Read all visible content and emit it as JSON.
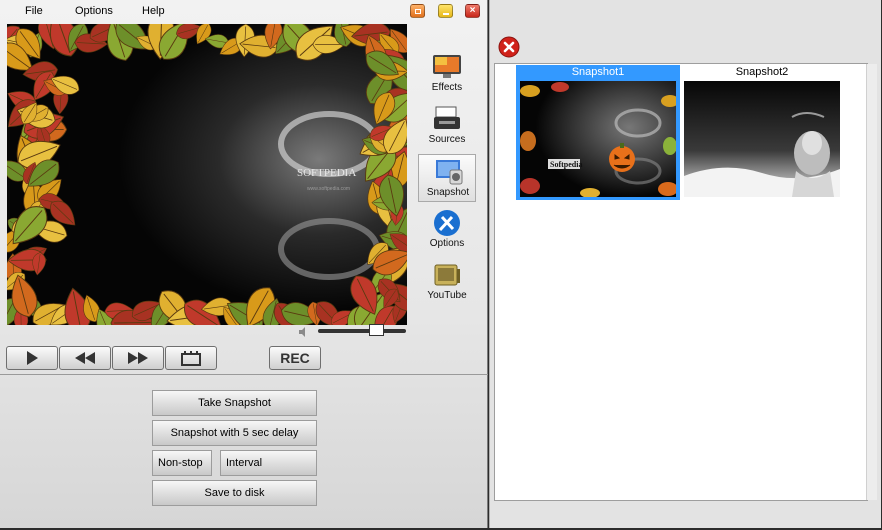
{
  "menu": {
    "items": [
      "File",
      "Options",
      "Help"
    ]
  },
  "window_controls": [
    "restore",
    "minimize",
    "close"
  ],
  "side_tools": [
    {
      "label": "Effects",
      "icon": "effects-monitor-icon",
      "active": false
    },
    {
      "label": "Sources",
      "icon": "sources-printer-icon",
      "active": false
    },
    {
      "label": "Snapshot",
      "icon": "snapshot-camera-icon",
      "active": true
    },
    {
      "label": "Options",
      "icon": "options-tools-icon",
      "active": false
    },
    {
      "label": "YouTube",
      "icon": "youtube-tv-icon",
      "active": false
    }
  ],
  "preview": {
    "watermark": "SOFTPEDIA",
    "caption": "www.softpedia.com"
  },
  "volume": {
    "level": 0.7
  },
  "controls": {
    "rec_label": "REC"
  },
  "actions": {
    "take_snapshot": "Take Snapshot",
    "snapshot_delay": "Snapshot with 5 sec delay",
    "non_stop": "Non-stop",
    "interval": "Interval",
    "save_to_disk": "Save to disk"
  },
  "snapshots": [
    {
      "title": "Snapshot1",
      "selected": true,
      "label": "Softpedia"
    },
    {
      "title": "Snapshot2",
      "selected": false
    }
  ],
  "colors": {
    "selection": "#3399ff",
    "close_red": "#d0221a"
  }
}
